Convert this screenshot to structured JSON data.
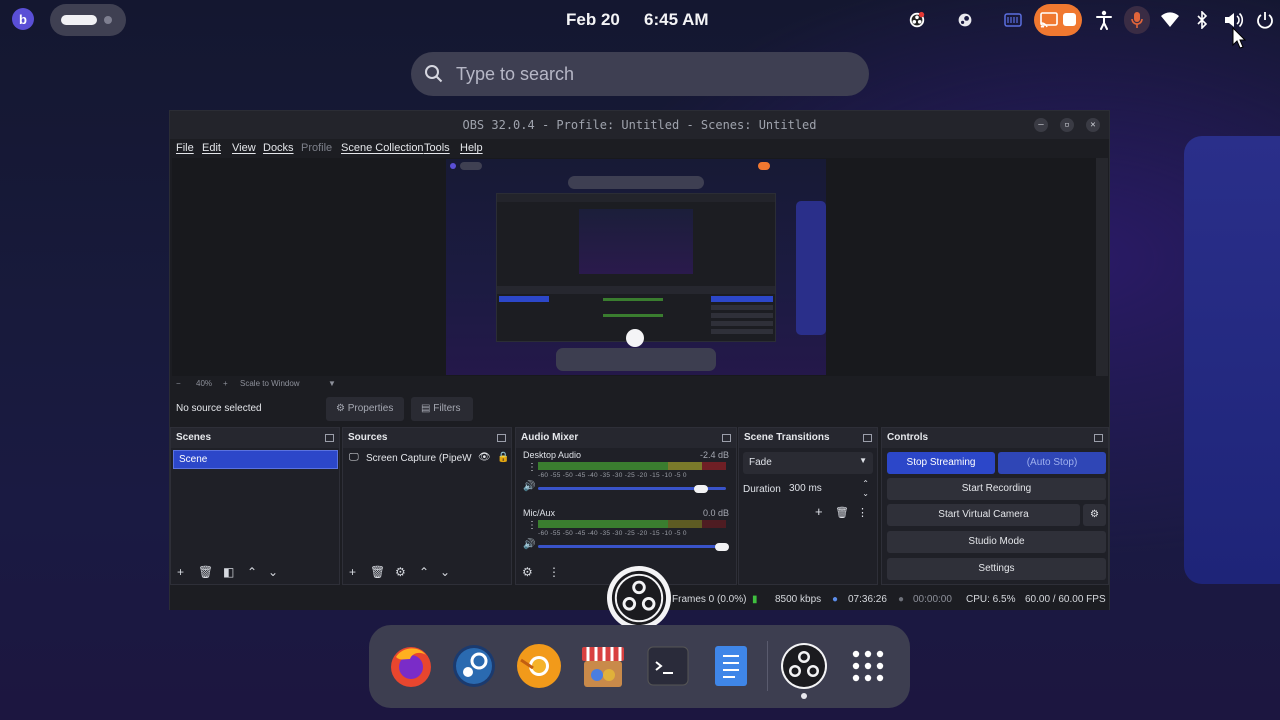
{
  "topbar": {
    "date": "Feb 20",
    "time": "6:45 AM",
    "tray_icons": [
      "obs-tray-icon",
      "steam-tray-icon",
      "keyboard-icon",
      "screencast-icon",
      "accessibility-icon",
      "microphone-icon",
      "wifi-icon",
      "bluetooth-icon",
      "volume-icon",
      "power-icon"
    ]
  },
  "search": {
    "placeholder": "Type to search"
  },
  "obs": {
    "title": "OBS 32.0.4 - Profile: Untitled - Scenes: Untitled",
    "menu": [
      "File",
      "Edit",
      "View",
      "Docks",
      "Profile",
      "Scene Collection",
      "Tools",
      "Help"
    ],
    "zoom": "40%",
    "scale_mode": "Scale to Window",
    "no_source": "No source selected",
    "properties": "Properties",
    "filters": "Filters",
    "scenes": {
      "title": "Scenes",
      "items": [
        "Scene"
      ]
    },
    "sources": {
      "title": "Sources",
      "items": [
        "Screen Capture (PipeW"
      ]
    },
    "mixer": {
      "title": "Audio Mixer",
      "channels": [
        {
          "name": "Desktop Audio",
          "db": "-2.4 dB"
        },
        {
          "name": "Mic/Aux",
          "db": "0.0 dB"
        }
      ],
      "scale": "-60 -55 -50 -45 -40 -35 -30 -25 -20 -15 -10 -5 0"
    },
    "transitions": {
      "title": "Scene Transitions",
      "type": "Fade",
      "duration_label": "Duration",
      "duration": "300 ms"
    },
    "controls": {
      "title": "Controls",
      "stop_streaming": "Stop Streaming",
      "auto_stop": "(Auto Stop)",
      "start_recording": "Start Recording",
      "start_virtual_camera": "Start Virtual Camera",
      "studio_mode": "Studio Mode",
      "settings": "Settings"
    },
    "status": {
      "frames": "Frames 0 (0.0%)",
      "bitrate": "8500 kbps",
      "stream_time": "07:36:26",
      "rec_time": "00:00:00",
      "cpu": "CPU: 6.5%",
      "fps": "60.00 / 60.00 FPS"
    }
  },
  "taskbar": {
    "apps": [
      "firefox-icon",
      "steam-icon",
      "chrome-canary-icon",
      "app-store-icon",
      "terminal-icon",
      "text-editor-icon",
      "obs-icon",
      "app-grid-icon"
    ]
  },
  "colors": {
    "accent_blue": "#2c47c9",
    "tray_orange": "#f07830",
    "mic_orange": "#e2653a"
  }
}
